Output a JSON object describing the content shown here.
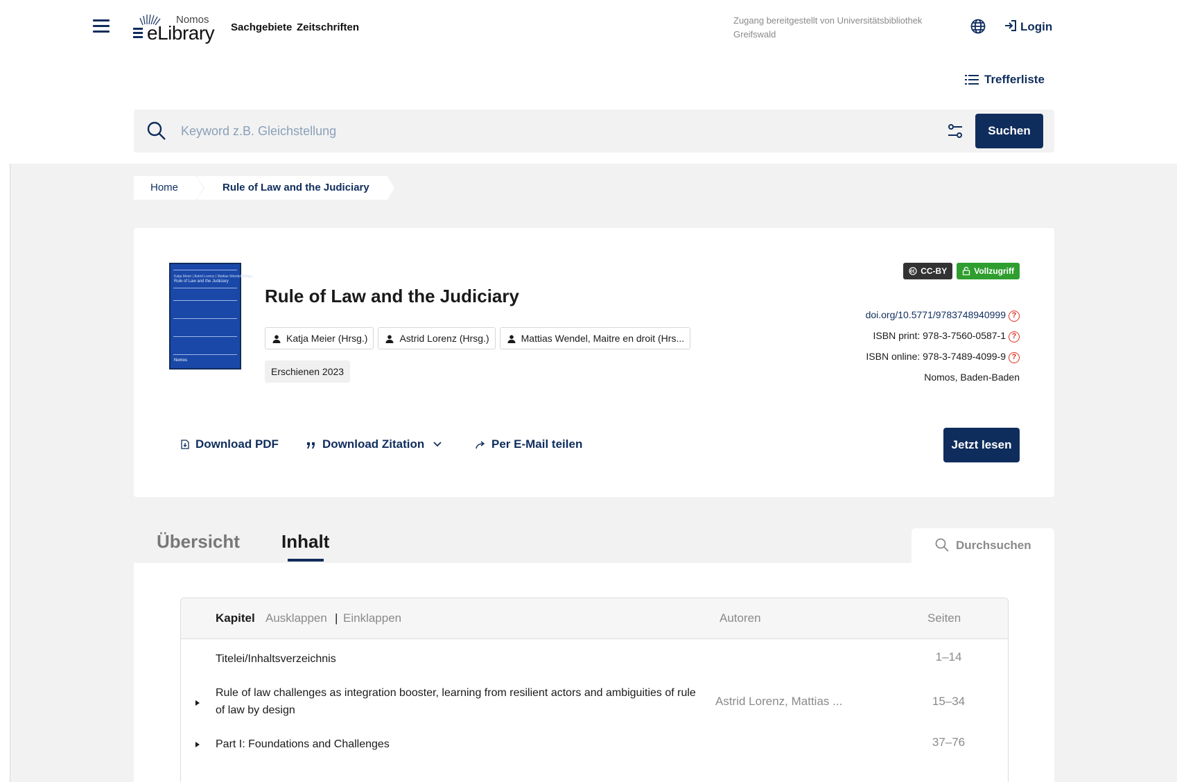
{
  "header": {
    "logo_top": "Nomos",
    "logo_main": "eLibrary",
    "nav": [
      "Sachgebiete",
      "Zeitschriften"
    ],
    "access_text": "Zugang bereitgestellt von Universitätsbibliothek Greifswald",
    "login_label": "Login",
    "trefferliste_label": "Trefferliste"
  },
  "search": {
    "placeholder": "Keyword z.B. Gleichstellung",
    "button_label": "Suchen"
  },
  "breadcrumb": {
    "home": "Home",
    "current": "Rule of Law and the Judiciary"
  },
  "book": {
    "cover_series": "Katja Meier | Astrid Lorenz | Mattias Wendel (Hrsg.)",
    "cover_title": "Rule of Law and the Judiciary",
    "cover_publisher": "Nomos",
    "title": "Rule of Law and the Judiciary",
    "authors": [
      "Katja Meier (Hrsg.)",
      "Astrid Lorenz (Hrsg.)",
      "Mattias Wendel, Maitre en droit (Hrs..."
    ],
    "year": "Erschienen 2023",
    "license_badge": "CC-BY",
    "access_badge": "Vollzugriff",
    "doi": "doi.org/10.5771/9783748940999",
    "isbn_print": "ISBN print: 978-3-7560-0587-1",
    "isbn_online": "ISBN online: 978-3-7489-4099-9",
    "publisher": "Nomos, Baden-Baden",
    "colors": {
      "primary": "#0f2d5c",
      "open_access": "#2f9e2f",
      "help": "#e0301e"
    }
  },
  "actions": {
    "download_pdf": "Download PDF",
    "download_citation": "Download Zitation",
    "share_email": "Per E-Mail teilen",
    "read_now": "Jetzt lesen"
  },
  "tabs": {
    "overview": "Übersicht",
    "content": "Inhalt",
    "search_in": "Durchsuchen"
  },
  "toc": {
    "col_chapter": "Kapitel",
    "expand": "Ausklappen",
    "separator": "|",
    "collapse": "Einklappen",
    "col_authors": "Autoren",
    "col_pages": "Seiten",
    "rows": [
      {
        "title": "Titelei/Inhaltsverzeichnis",
        "authors": "",
        "pages": "1–14"
      },
      {
        "title": "Rule of law challenges as integration booster, learning from resilient actors and ambiguities of rule of law by design",
        "authors": "Astrid Lorenz, Mattias ...",
        "pages": "15–34"
      },
      {
        "title": "Part I: Foundations and Challenges",
        "authors": "",
        "pages": "37–76"
      }
    ]
  }
}
